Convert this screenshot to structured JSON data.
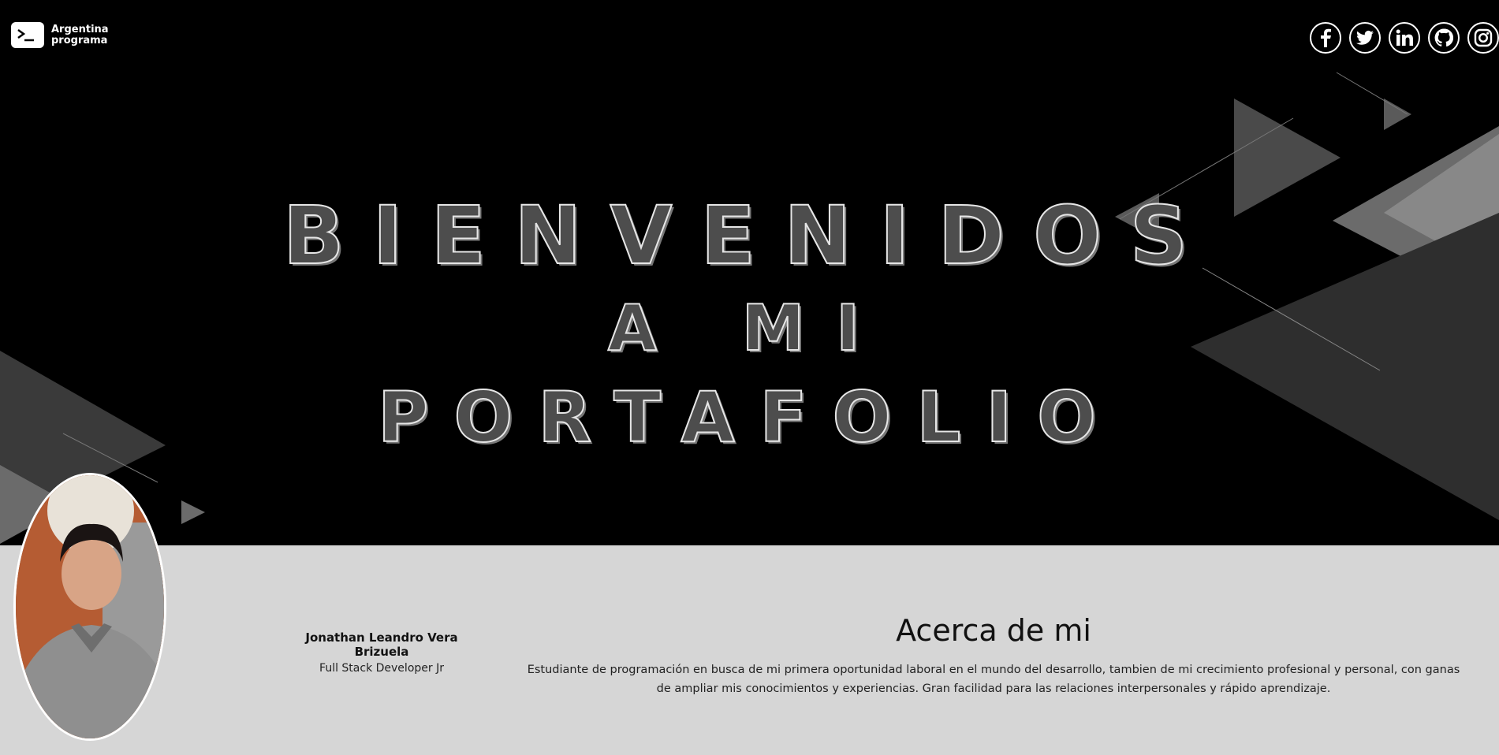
{
  "brand": {
    "line1": "Argentina",
    "line2": "programa"
  },
  "social": [
    {
      "name": "facebook"
    },
    {
      "name": "twitter"
    },
    {
      "name": "linkedin"
    },
    {
      "name": "github"
    },
    {
      "name": "instagram"
    }
  ],
  "hero": {
    "line1": "BIENVENIDOS",
    "line2": "A MI",
    "line3": "PORTAFOLIO"
  },
  "profile": {
    "name": "Jonathan Leandro Vera Brizuela",
    "role": "Full Stack Developer Jr"
  },
  "about": {
    "title": "Acerca de mi",
    "text": "Estudiante de programación en busca de mi primera oportunidad laboral en el mundo del desarrollo, tambien de mi crecimiento profesional y personal, con ganas de ampliar mis conocimientos y experiencias. Gran facilidad para las relaciones interpersonales y rápido aprendizaje."
  },
  "colors": {
    "hero_bg": "#000000",
    "section_bg": "#d6d6d6",
    "title_fill": "#4d4d4d"
  }
}
